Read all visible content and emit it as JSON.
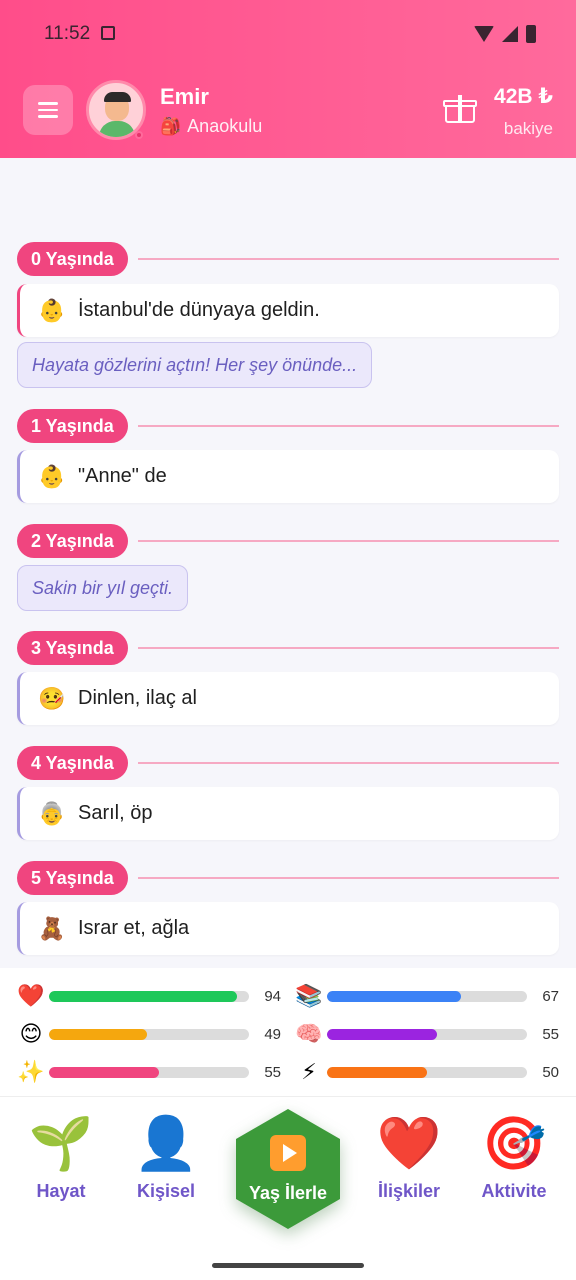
{
  "status_bar": {
    "time": "11:52"
  },
  "header": {
    "name": "Emir",
    "level_emoji": "🎒",
    "level": "Anaokulu",
    "balance": "42B ₺",
    "balance_label": "bakiye"
  },
  "timeline": [
    {
      "age": "0 Yaşında",
      "event_emoji": "👶",
      "event": "İstanbul'de dünyaya geldin.",
      "note": "Hayata gözlerini açtın! Her şey önünde..."
    },
    {
      "age": "1 Yaşında",
      "event_emoji": "👶",
      "event": "\"Anne\" de",
      "note": ""
    },
    {
      "age": "2 Yaşında",
      "event_emoji": "",
      "event": "",
      "note": "Sakin bir yıl geçti."
    },
    {
      "age": "3 Yaşında",
      "event_emoji": "🤒",
      "event": "Dinlen, ilaç al",
      "note": ""
    },
    {
      "age": "4 Yaşında",
      "event_emoji": "👵",
      "event": "Sarıl, öp",
      "note": ""
    },
    {
      "age": "5 Yaşında",
      "event_emoji": "🧸",
      "event": "Israr et, ağla",
      "note": ""
    }
  ],
  "stats": [
    {
      "icon": "❤️",
      "name": "health-stat",
      "value": 94,
      "color": "#1ec85a"
    },
    {
      "icon": "📚",
      "name": "intelligence-stat",
      "value": 67,
      "color": "#3b82f6"
    },
    {
      "icon": "😊",
      "name": "happiness-stat",
      "value": 49,
      "color": "#f5a70e"
    },
    {
      "icon": "🧠",
      "name": "mind-stat",
      "value": 55,
      "color": "#9b24e0"
    },
    {
      "icon": "✨",
      "name": "looks-stat",
      "value": 55,
      "color": "#f0457f"
    },
    {
      "icon": "⚡",
      "name": "energy-stat",
      "value": 50,
      "color": "#f97316"
    }
  ],
  "nav": {
    "hayat": {
      "label": "Hayat",
      "icon": "🌱"
    },
    "kisisel": {
      "label": "Kişisel",
      "icon": "👤"
    },
    "center": {
      "label": "Yaş İlerle",
      "icon": "play"
    },
    "iliskiler": {
      "label": "İlişkiler",
      "icon": "❤️"
    },
    "aktivite": {
      "label": "Aktivite",
      "icon": "🎯"
    }
  },
  "colors": {
    "header": "#ff5c92",
    "accent": "#f0457f",
    "nav_label": "#6f56c8",
    "center_button": "#3c9a3a"
  }
}
